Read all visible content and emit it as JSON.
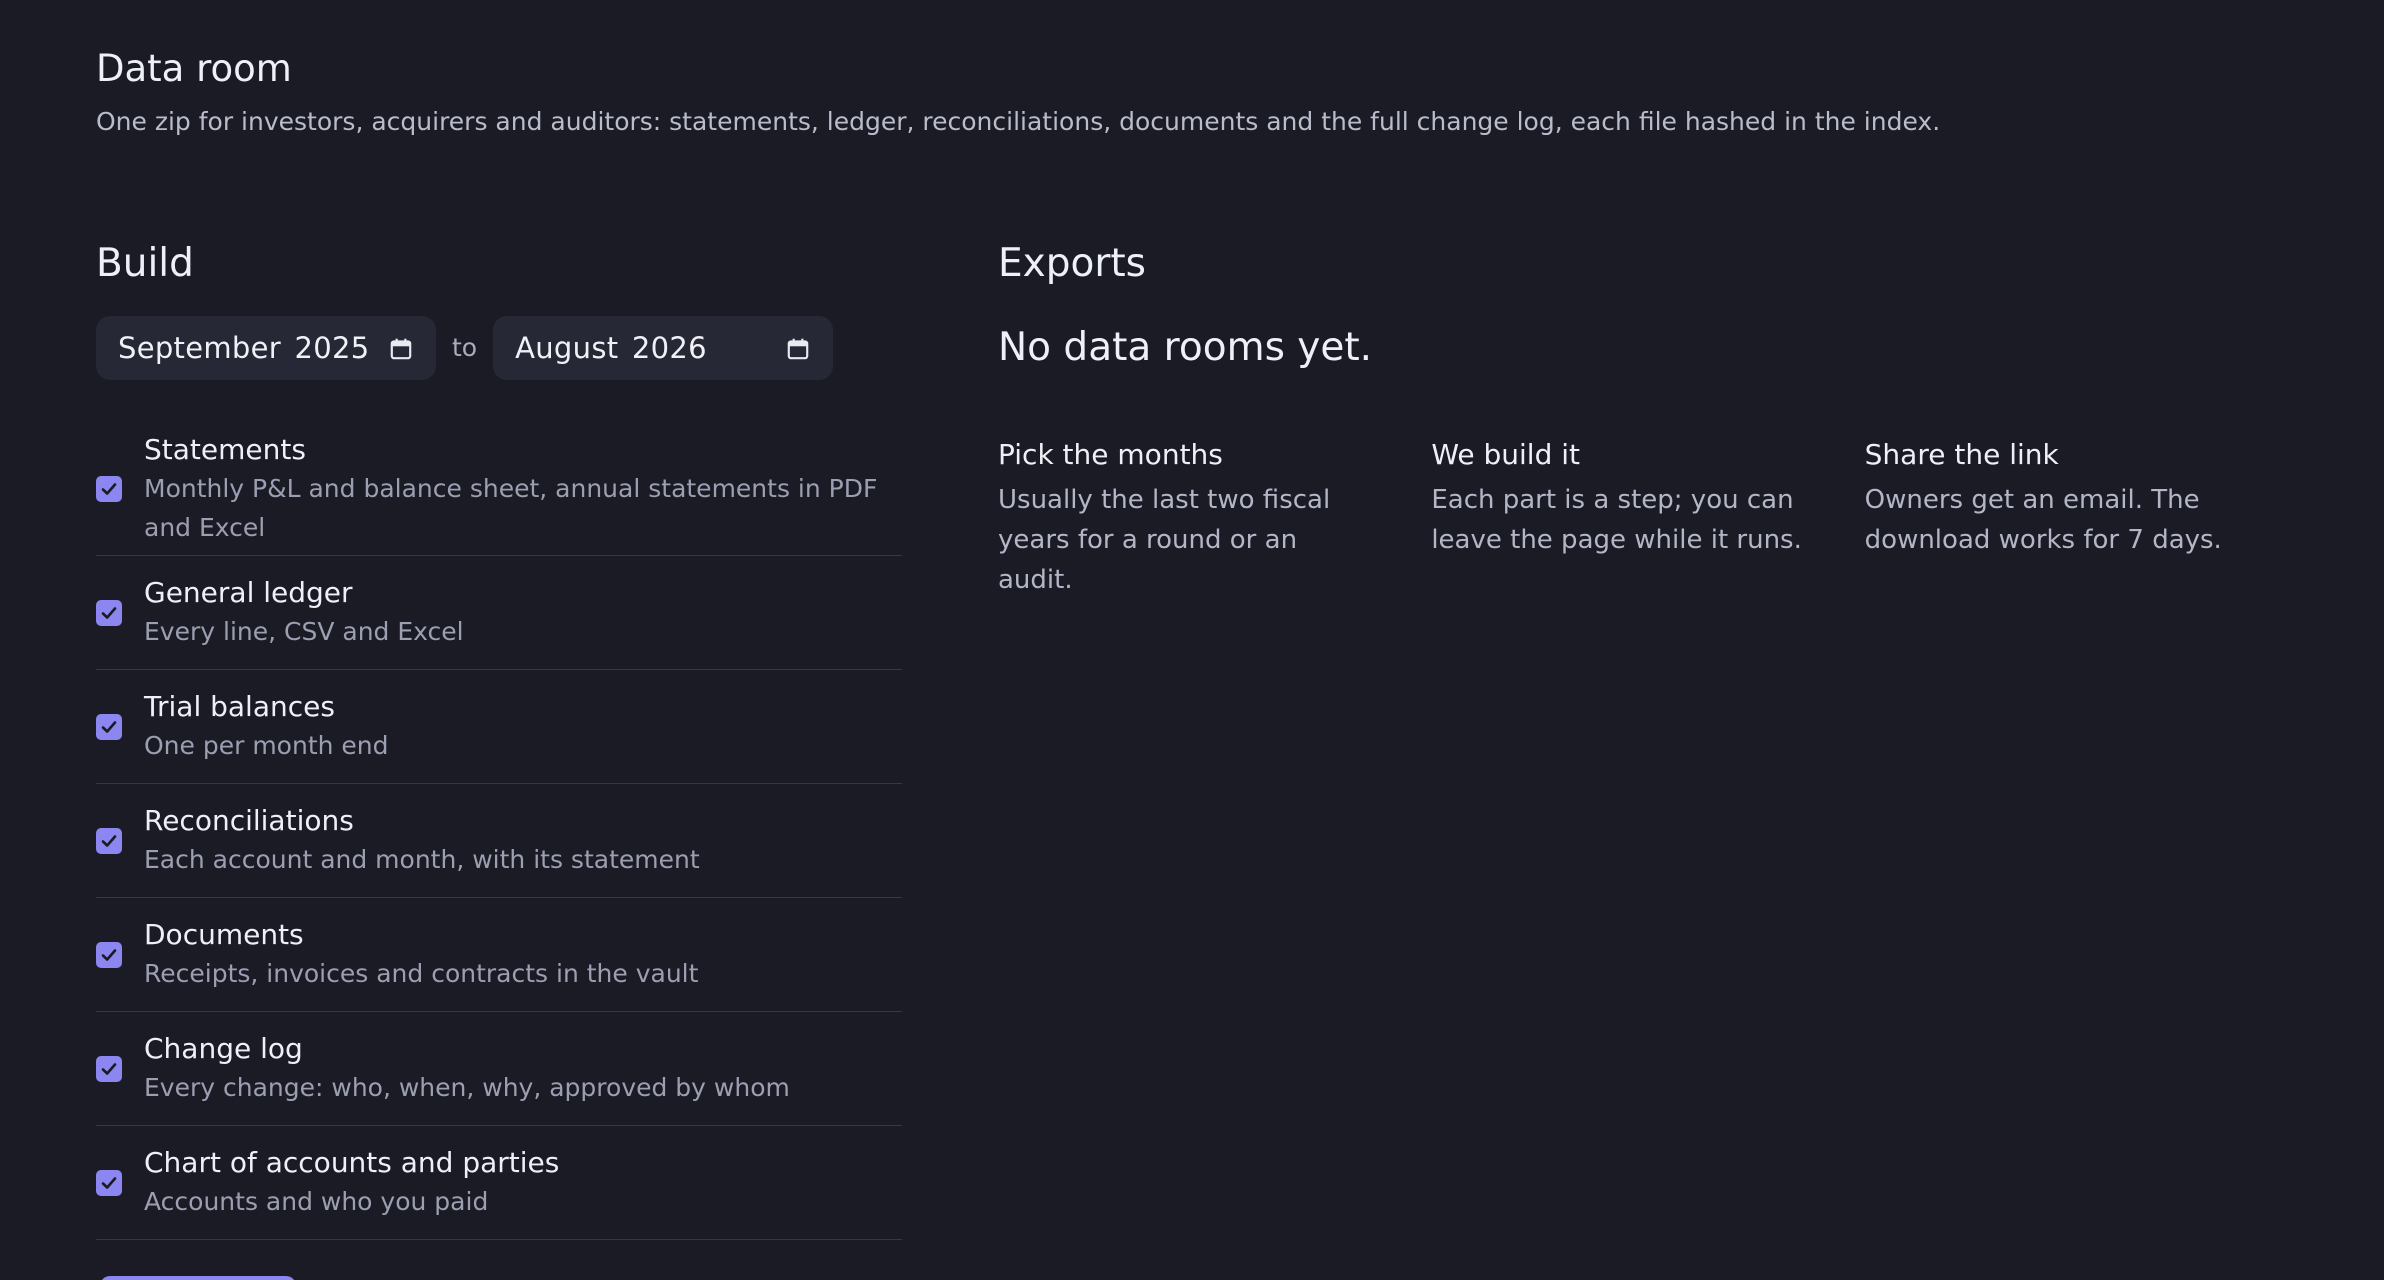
{
  "header": {
    "title": "Data room",
    "description": "One zip for investors, acquirers and auditors: statements, ledger, reconciliations, documents and the full change log, each file hashed in the index."
  },
  "build": {
    "title": "Build",
    "date_from": "September 2025",
    "date_to": "August 2026",
    "to_label": "to",
    "options": [
      {
        "title": "Statements",
        "description": "Monthly P&L and balance sheet, annual statements in PDF and Excel",
        "checked": true
      },
      {
        "title": "General ledger",
        "description": "Every line, CSV and Excel",
        "checked": true
      },
      {
        "title": "Trial balances",
        "description": "One per month end",
        "checked": true
      },
      {
        "title": "Reconciliations",
        "description": "Each account and month, with its statement",
        "checked": true
      },
      {
        "title": "Documents",
        "description": "Receipts, invoices and contracts in the vault",
        "checked": true
      },
      {
        "title": "Change log",
        "description": "Every change: who, when, why, approved by whom",
        "checked": true
      },
      {
        "title": "Chart of accounts and parties",
        "description": "Accounts and who you paid",
        "checked": true
      }
    ]
  },
  "exports": {
    "title": "Exports",
    "empty_title": "No data rooms yet.",
    "steps": [
      {
        "title": "Pick the months",
        "description": "Usually the last two fiscal years for a round or an audit."
      },
      {
        "title": "We build it",
        "description": "Each part is a step; you can leave the page while it runs."
      },
      {
        "title": "Share the link",
        "description": "Owners get an email. The download works for 7 days."
      }
    ]
  },
  "colors": {
    "background": "#1a1b25",
    "input_background": "#272835",
    "accent": "#8b86f0",
    "divider": "#34364a"
  },
  "icons": {
    "date_picker": "calendar-icon",
    "checkbox": "check-icon"
  }
}
